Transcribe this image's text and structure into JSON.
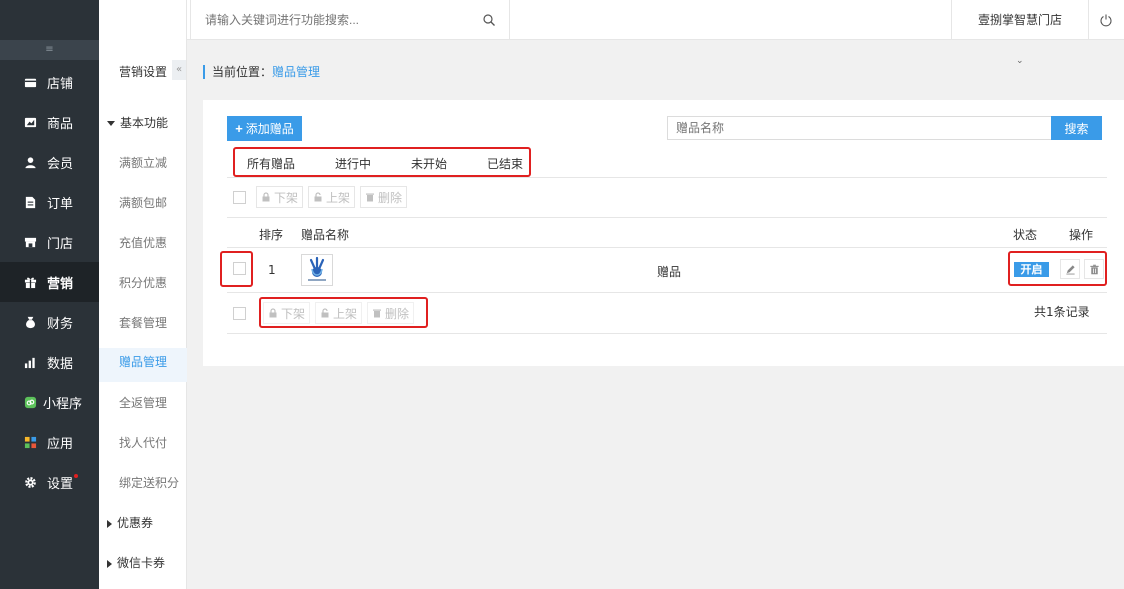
{
  "sidebar": {
    "collapse_icon": "collapse-lines-icon",
    "items": [
      {
        "label": "店铺",
        "icon": "store-icon"
      },
      {
        "label": "商品",
        "icon": "goods-icon"
      },
      {
        "label": "会员",
        "icon": "member-icon"
      },
      {
        "label": "订单",
        "icon": "order-icon"
      },
      {
        "label": "门店",
        "icon": "shop-icon"
      },
      {
        "label": "营销",
        "icon": "gift-icon",
        "active": true
      },
      {
        "label": "财务",
        "icon": "money-bag-icon"
      },
      {
        "label": "数据",
        "icon": "data-chart-icon"
      },
      {
        "label": "小程序",
        "icon": "miniprogram-icon"
      },
      {
        "label": "应用",
        "icon": "apps-icon"
      },
      {
        "label": "设置",
        "icon": "gear-icon",
        "badge_dot": true
      }
    ]
  },
  "submenu": {
    "title": "营销设置",
    "collapse_label": "«",
    "groups": [
      {
        "label": "基本功能",
        "expanded": true
      },
      {
        "label": "优惠券",
        "expanded": false
      },
      {
        "label": "微信卡券",
        "expanded": false
      }
    ],
    "items": [
      {
        "label": "满额立减"
      },
      {
        "label": "满额包邮"
      },
      {
        "label": "充值优惠"
      },
      {
        "label": "积分优惠"
      },
      {
        "label": "套餐管理"
      },
      {
        "label": "赠品管理",
        "active": true
      },
      {
        "label": "全返管理"
      },
      {
        "label": "找人代付"
      },
      {
        "label": "绑定送积分"
      }
    ]
  },
  "topbar": {
    "search_placeholder": "请输入关键词进行功能搜索...",
    "store_name": "壹捌掌智慧门店"
  },
  "breadcrumb": {
    "prefix": "当前位置：",
    "current": "赠品管理"
  },
  "toolbar": {
    "add_label": "添加赠品",
    "search_placeholder": "赠品名称",
    "search_button": "搜索"
  },
  "tabs": [
    "所有赠品",
    "进行中",
    "未开始",
    "已结束"
  ],
  "bulk_actions": {
    "unshelve": "下架",
    "shelve": "上架",
    "delete": "删除"
  },
  "table": {
    "columns": {
      "order": "排序",
      "name": "赠品名称",
      "status": "状态",
      "action": "操作"
    },
    "rows": [
      {
        "order": "1",
        "name": "赠品",
        "status": "开启"
      }
    ],
    "total": "共1条记录"
  },
  "colors": {
    "accent": "#3a9be8",
    "sidebar_bg": "#2b3238",
    "highlight_red": "#e02020"
  }
}
